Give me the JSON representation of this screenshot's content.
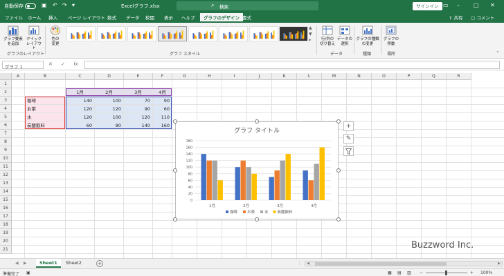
{
  "titlebar": {
    "autosave_label": "自動保存",
    "autosave_state": "オフ",
    "doc_title": "Excelグラフ.xlsx",
    "search_placeholder": "検索",
    "signin_label": "サインイン"
  },
  "tabs": [
    "ファイル",
    "ホーム",
    "挿入",
    "ページ レイアウト",
    "数式",
    "データ",
    "校閲",
    "表示",
    "ヘルプ",
    "グラフのデザイン",
    "書式"
  ],
  "active_tab": "グラフのデザイン",
  "share_label": "共有",
  "comment_label": "コメント",
  "ribbon": {
    "add_element": "グラフ要素\nを追加",
    "quick_layout": "クイック\nレイアウト",
    "change_colors": "色の\n変更",
    "layout_group": "グラフのレイアウト",
    "styles_group": "グラフ スタイル",
    "switch_row_col": "行/列の\n切り替え",
    "select_data": "データの\n選択",
    "data_group": "データ",
    "change_type": "グラフの種類\nの変更",
    "type_group": "種類",
    "move_chart": "グラフの\n移動",
    "location_group": "場所"
  },
  "formula_bar": {
    "name_box": "グラフ 1",
    "fx": "fx"
  },
  "columns": [
    "A",
    "B",
    "C",
    "D",
    "E",
    "F",
    "G",
    "H",
    "I",
    "J",
    "K",
    "L",
    "M",
    "N",
    "O",
    "P",
    "Q",
    "R"
  ],
  "rows": [
    "1",
    "2",
    "3",
    "4",
    "5",
    "6",
    "7",
    "8",
    "9",
    "10",
    "11",
    "12",
    "13",
    "14",
    "15",
    "16",
    "17",
    "18",
    "19",
    "20",
    "21"
  ],
  "table": {
    "months": [
      "1月",
      "2月",
      "3月",
      "4月"
    ],
    "items": [
      {
        "name": "珈琲",
        "values": [
          140,
          100,
          70,
          90
        ]
      },
      {
        "name": "お茶",
        "values": [
          120,
          120,
          90,
          60
        ]
      },
      {
        "name": "水",
        "values": [
          120,
          100,
          120,
          110
        ]
      },
      {
        "name": "炭酸飲料",
        "values": [
          60,
          80,
          140,
          160
        ]
      }
    ]
  },
  "chart_data": {
    "type": "bar",
    "title": "グラフ タイトル",
    "categories": [
      "1月",
      "2月",
      "3月",
      "4月"
    ],
    "series": [
      {
        "name": "珈琲",
        "color": "#4472c4",
        "values": [
          140,
          100,
          70,
          90
        ]
      },
      {
        "name": "お茶",
        "color": "#ed7d31",
        "values": [
          120,
          120,
          90,
          60
        ]
      },
      {
        "name": "水",
        "color": "#a5a5a5",
        "values": [
          120,
          100,
          120,
          110
        ]
      },
      {
        "name": "炭酸飲料",
        "color": "#ffc000",
        "values": [
          60,
          80,
          140,
          160
        ]
      }
    ],
    "ylim": [
      0,
      180
    ],
    "yticks": [
      0,
      20,
      40,
      60,
      80,
      100,
      120,
      140,
      160,
      180
    ],
    "grid": true,
    "legend_position": "bottom"
  },
  "sheets": [
    "Sheet1",
    "Sheet2"
  ],
  "active_sheet": "Sheet1",
  "status": {
    "ready": "準備完了",
    "zoom": "100%"
  },
  "watermark": "Buzzword Inc."
}
